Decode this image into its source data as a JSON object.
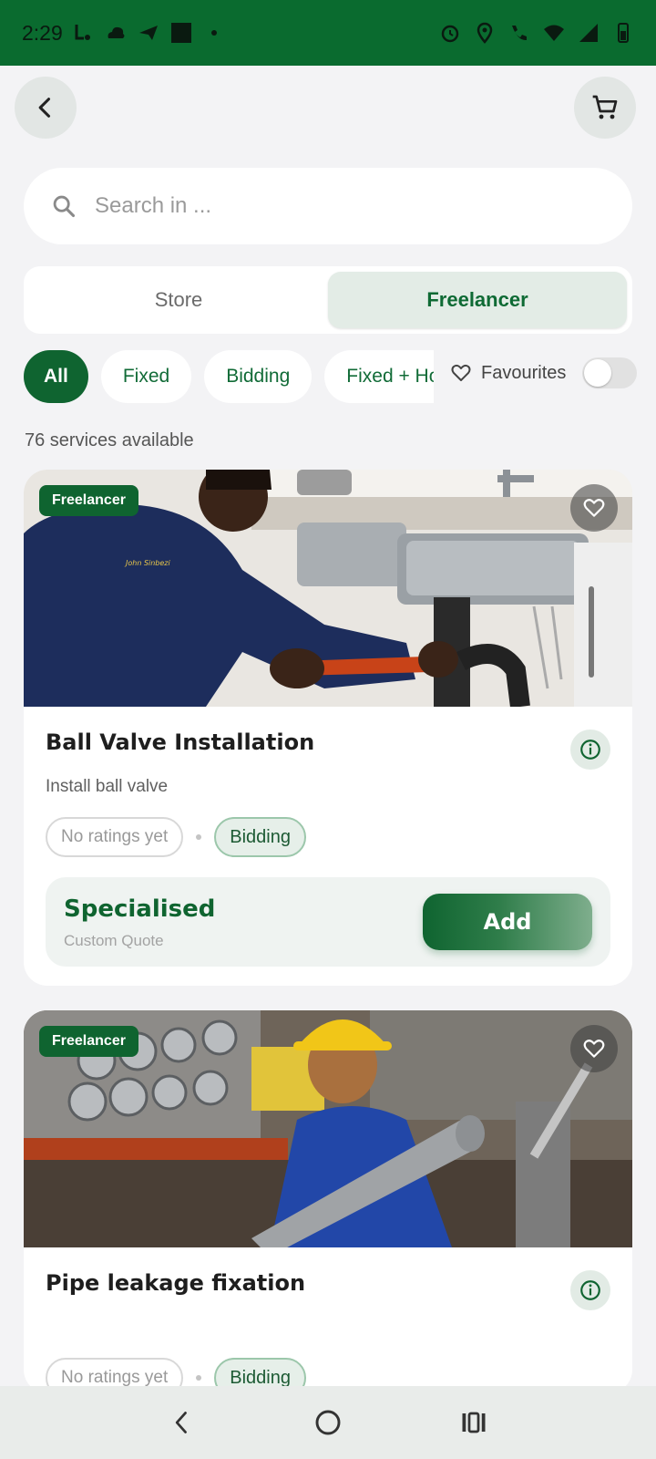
{
  "status_bar": {
    "time": "2:29",
    "left_icons": [
      "notification-icon",
      "cloud-icon",
      "send-icon",
      "app-square-icon",
      "dot-icon"
    ],
    "right_icons": [
      "alarm-icon",
      "location-icon",
      "wifi-calling-icon",
      "wifi-icon",
      "signal-icon",
      "battery-icon"
    ]
  },
  "header": {
    "back_icon": "chevron-left-icon",
    "cart_icon": "cart-icon"
  },
  "search": {
    "placeholder": "Search in ...",
    "value": ""
  },
  "segment": {
    "tabs": [
      {
        "label": "Store",
        "active": false
      },
      {
        "label": "Freelancer",
        "active": true
      }
    ]
  },
  "filters": {
    "chips": [
      {
        "label": "All",
        "active": true
      },
      {
        "label": "Fixed",
        "active": false
      },
      {
        "label": "Bidding",
        "active": false
      },
      {
        "label": "Fixed + Hourly",
        "active": false
      }
    ],
    "favourites_label": "Favourites",
    "favourites_on": false
  },
  "results": {
    "count_text": "76 services available"
  },
  "services": [
    {
      "badge": "Freelancer",
      "title": "Ball Valve Installation",
      "description": "Install ball valve",
      "rating": "No ratings yet",
      "pricing_type": "Bidding",
      "price_label": "Specialised",
      "price_sub": "Custom Quote",
      "action": "Add"
    },
    {
      "badge": "Freelancer",
      "title": "Pipe leakage fixation",
      "description": "",
      "rating": "No ratings yet",
      "pricing_type": "Bidding"
    }
  ],
  "colors": {
    "brand_green": "#0f6430",
    "status_bar": "#0a6b2f",
    "background": "#f3f3f5"
  }
}
